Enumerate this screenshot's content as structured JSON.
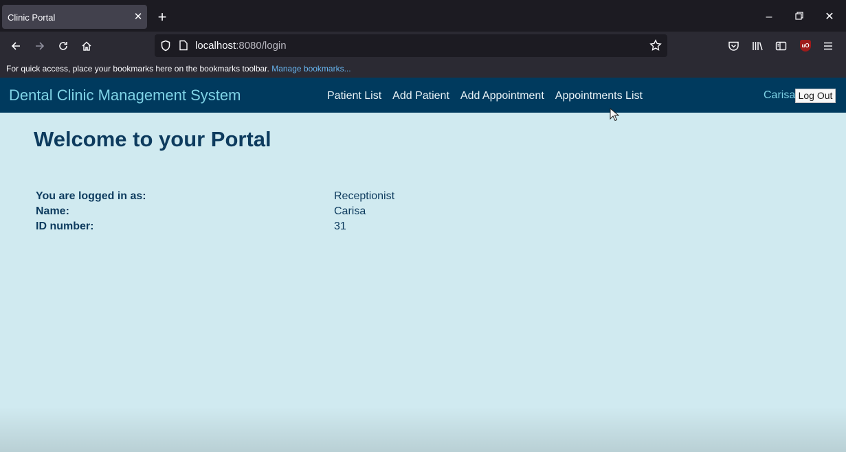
{
  "browser": {
    "tab_title": "Clinic Portal",
    "url_host": "localhost",
    "url_rest": ":8080/login",
    "bookmarks_text": "For quick access, place your bookmarks here on the bookmarks toolbar.",
    "bookmarks_link": "Manage bookmarks..."
  },
  "site": {
    "brand": "Dental Clinic Management System",
    "nav": [
      "Patient List",
      "Add Patient",
      "Add Appointment",
      "Appointments List"
    ],
    "user_name": "Carisa",
    "logout_label": "Log Out"
  },
  "main": {
    "heading": "Welcome to your Portal",
    "info": [
      {
        "label": "You are logged in as:",
        "value": "Receptionist"
      },
      {
        "label": "Name:",
        "value": "Carisa"
      },
      {
        "label": "ID number:",
        "value": "31"
      }
    ]
  },
  "colors": {
    "header_bg": "#003a5e",
    "brand_color": "#7fd3e6",
    "page_bg": "#d0eaf0",
    "text_dark": "#0d3b5e"
  }
}
